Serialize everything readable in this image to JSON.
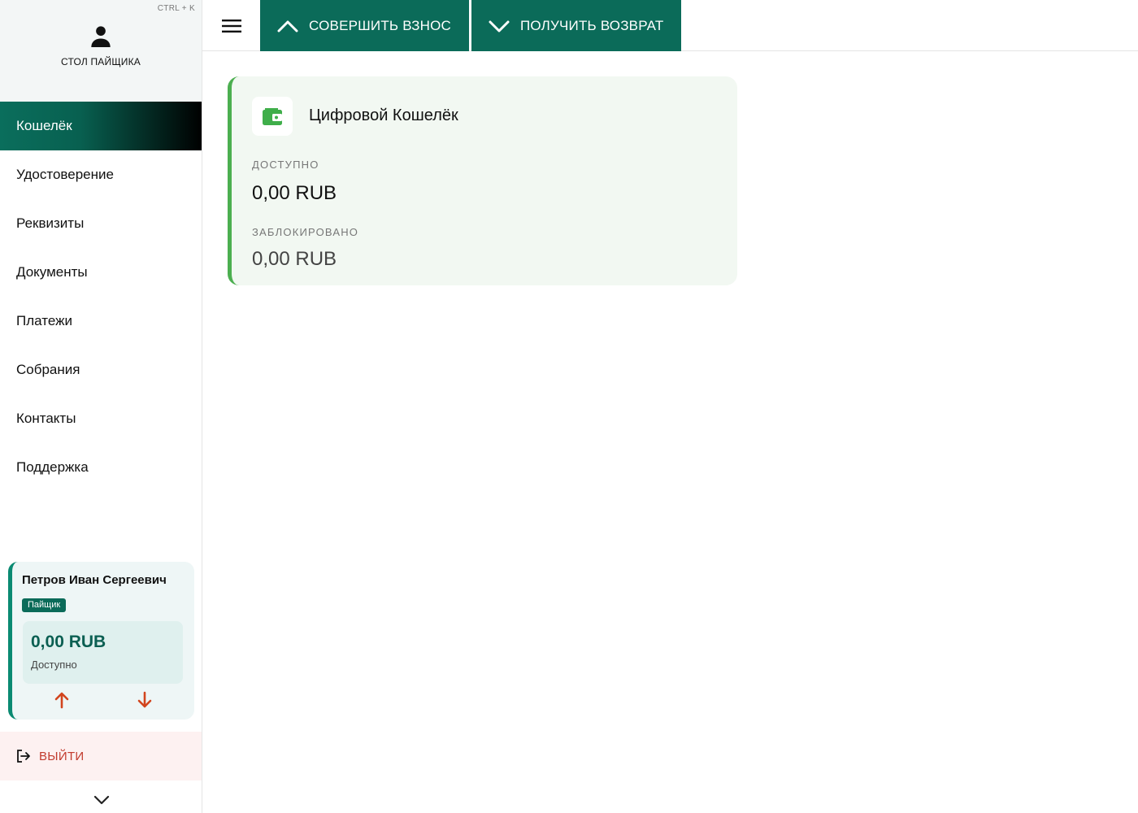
{
  "sidebar": {
    "shortcut": "CTRL + K",
    "title": "СТОЛ ПАЙЩИКА",
    "items": [
      {
        "label": "Кошелёк",
        "active": true
      },
      {
        "label": "Удостоверение"
      },
      {
        "label": "Реквизиты"
      },
      {
        "label": "Документы"
      },
      {
        "label": "Платежи"
      },
      {
        "label": "Собрания"
      },
      {
        "label": "Контакты"
      },
      {
        "label": "Поддержка"
      }
    ],
    "user": {
      "name": "Петров Иван Сергеевич",
      "role": "Пайщик",
      "balance": "0,00 RUB",
      "balance_label": "Доступно"
    },
    "logout_label": "ВЫЙТИ"
  },
  "topbar": {
    "deposit_label": "СОВЕРШИТЬ ВЗНОС",
    "withdraw_label": "ПОЛУЧИТЬ ВОЗВРАТ"
  },
  "wallet": {
    "title": "Цифровой Кошелёк",
    "available_label": "ДОСТУПНО",
    "available_value": "0,00 RUB",
    "blocked_label": "ЗАБЛОКИРОВАНО",
    "blocked_value": "0,00 RUB"
  },
  "colors": {
    "brand": "#0b6b59",
    "wallet_accent": "#4caf50",
    "logout": "#c23b2e",
    "arrow": "#d2451e"
  },
  "icons": {
    "user": "user-icon",
    "menu": "menu-icon",
    "deposit": "chevron-up-icon",
    "withdraw": "chevron-down-icon",
    "theme": "moon-icon",
    "wallet": "wallet-icon",
    "arrow_up": "arrow-up-icon",
    "arrow_down": "arrow-down-icon",
    "logout": "logout-icon",
    "collapse": "chevron-down-icon"
  }
}
